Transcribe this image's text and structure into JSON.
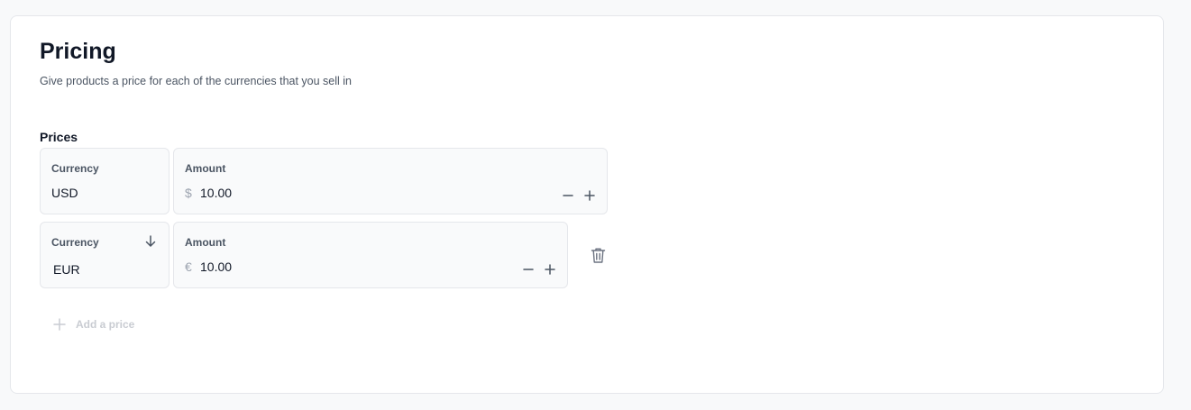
{
  "pricing": {
    "title": "Pricing",
    "subtitle": "Give products a price for each of the currencies that you sell in",
    "prices_label": "Prices",
    "rows": [
      {
        "currency_label": "Currency",
        "currency": "USD",
        "amount_label": "Amount",
        "symbol": "$",
        "amount": "10.00"
      },
      {
        "currency_label": "Currency",
        "currency": "EUR",
        "amount_label": "Amount",
        "symbol": "€",
        "amount": "10.00"
      }
    ],
    "add_price_label": "Add a price"
  },
  "icons": {
    "minus": "minus-icon",
    "plus": "plus-icon",
    "arrow_down": "arrow-down-icon",
    "trash": "trash-icon",
    "add": "plus-icon"
  },
  "colors": {
    "title": "#111827",
    "muted": "#4b5563",
    "field_bg": "#f9fafb",
    "field_border": "#e5e7eb",
    "disabled": "#c9ccd2"
  }
}
